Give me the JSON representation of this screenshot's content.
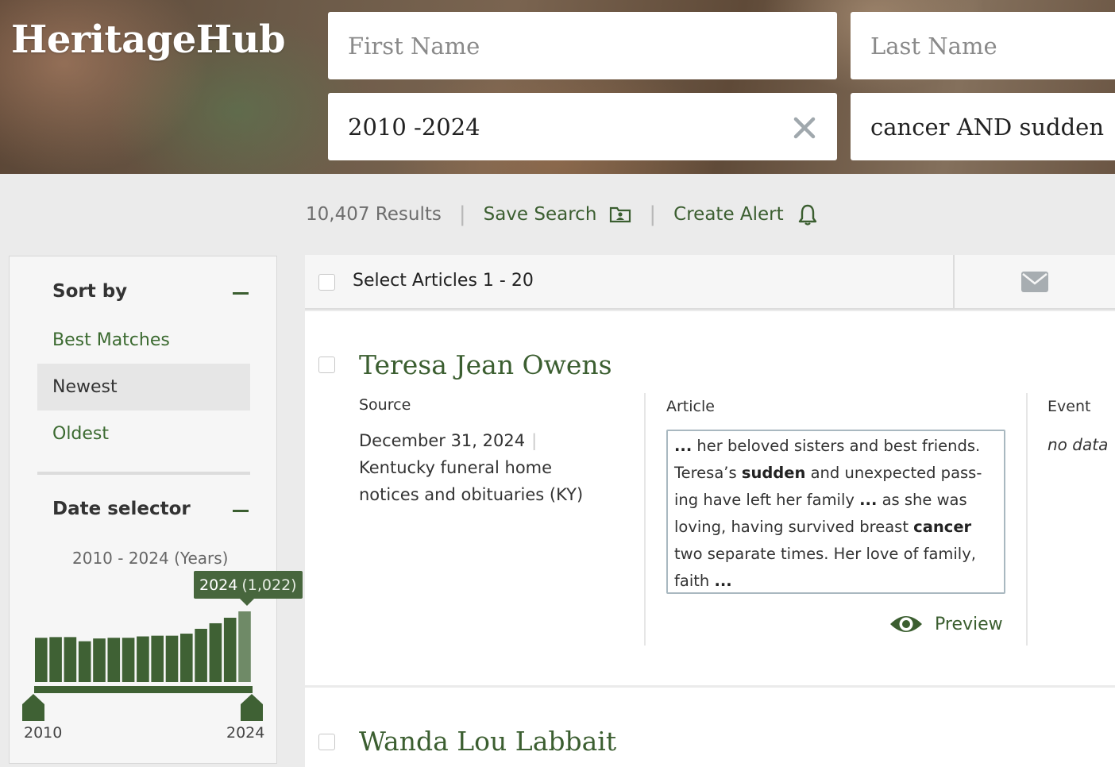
{
  "header": {
    "logo": "HeritageHub",
    "first_name_placeholder": "First Name",
    "last_name_placeholder": "Last Name",
    "date_value": "2010 -2024",
    "keywords_value": "cancer AND sudden"
  },
  "results_bar": {
    "count": "10,407 Results",
    "save_search": "Save Search",
    "create_alert": "Create Alert",
    "separator": "|"
  },
  "sidebar": {
    "sort_heading": "Sort by",
    "sort_options": [
      "Best Matches",
      "Newest",
      "Oldest"
    ],
    "sort_selected": "Newest",
    "date_heading": "Date selector",
    "date_range_label": "2010 - 2024 (Years)",
    "tooltip_year": "2024",
    "tooltip_count": "(1,022)",
    "range_start": "2010",
    "range_end": "2024"
  },
  "chart_data": {
    "type": "bar",
    "categories": [
      "2010",
      "2011",
      "2012",
      "2013",
      "2014",
      "2015",
      "2016",
      "2017",
      "2018",
      "2019",
      "2020",
      "2021",
      "2022",
      "2023",
      "2024"
    ],
    "values": [
      640,
      650,
      650,
      590,
      630,
      640,
      640,
      660,
      670,
      670,
      700,
      770,
      850,
      930,
      1022
    ],
    "highlighted": "2024",
    "colors": {
      "bar": "#3f6134",
      "highlight": "#6f8a67"
    }
  },
  "results": {
    "select_label": "Select Articles 1 - 20",
    "columns": {
      "source": "Source",
      "article": "Article",
      "event": "Event"
    },
    "items": [
      {
        "title": "Teresa Jean Owens",
        "source_date": "December 31, 2024",
        "source_name": "Kentucky funeral home notices and obituaries (KY)",
        "snippet_parts": [
          "...",
          " her beloved sisters and best friends. Teresa’s ",
          "sudden",
          " and unexpected pass-ing have left her family ",
          "...",
          " as she was loving, having survived breast ",
          "cancer",
          " two separate times. Her love of family, faith ",
          "..."
        ],
        "event": "no data",
        "preview_label": "Preview"
      },
      {
        "title": "Wanda Lou Labbait"
      }
    ]
  },
  "colors": {
    "brand_green": "#3b5e30",
    "accent_green": "#47663d"
  }
}
